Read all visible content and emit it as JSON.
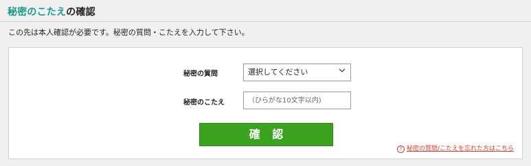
{
  "header": {
    "title_accent": "秘密のこたえ",
    "title_rest": "の確認"
  },
  "intro_text": "この先は本人確認が必要です。秘密の質問・こたえを入力して下さい。",
  "form": {
    "question_label": "秘密の質問",
    "question_selected": "選択してください",
    "answer_label": "秘密のこたえ",
    "answer_placeholder": "（ひらがな10文字以内)",
    "answer_value": "",
    "confirm_label": "確 認",
    "forgot_link": "秘密の質問/こたえを忘れた方はこちら",
    "help_icon_glyph": "?"
  },
  "colors": {
    "accent_teal": "#1a9a8a",
    "button_green": "#3aa21f",
    "link_red": "#d23c2a"
  },
  "icons": [
    "chevron-down-icon",
    "help-circle-icon"
  ]
}
